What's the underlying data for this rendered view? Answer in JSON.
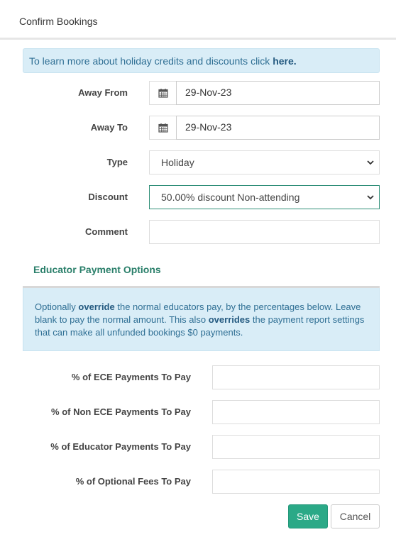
{
  "header": {
    "title": "Confirm Bookings"
  },
  "info": {
    "text": "To learn more about holiday credits and discounts click ",
    "link": "here."
  },
  "form": {
    "away_from": {
      "label": "Away From",
      "value": "29-Nov-23",
      "icon": "calendar-icon"
    },
    "away_to": {
      "label": "Away To",
      "value": "29-Nov-23",
      "icon": "calendar-icon"
    },
    "type": {
      "label": "Type",
      "value": "Holiday"
    },
    "discount": {
      "label": "Discount",
      "value": "50.00% discount Non-attending"
    },
    "comment": {
      "label": "Comment",
      "value": ""
    }
  },
  "educator": {
    "title": "Educator Payment Options",
    "info_parts": [
      "Optionally ",
      "override",
      " the normal educators pay, by the percentages below. Leave blank to pay the normal amount. This also ",
      "overrides",
      " the payment report settings that can make all unfunded bookings $0 payments."
    ],
    "fields": [
      {
        "label": "% of ECE Payments To Pay",
        "value": ""
      },
      {
        "label": "% of Non ECE Payments To Pay",
        "value": ""
      },
      {
        "label": "% of Educator Payments To Pay",
        "value": ""
      },
      {
        "label": "% of Optional Fees To Pay",
        "value": ""
      }
    ]
  },
  "buttons": {
    "save": "Save",
    "cancel": "Cancel"
  },
  "colors": {
    "accent": "#2ba987",
    "info_bg": "#d9edf7",
    "info_text": "#2f6f94",
    "section_title": "#2a7f6a"
  }
}
